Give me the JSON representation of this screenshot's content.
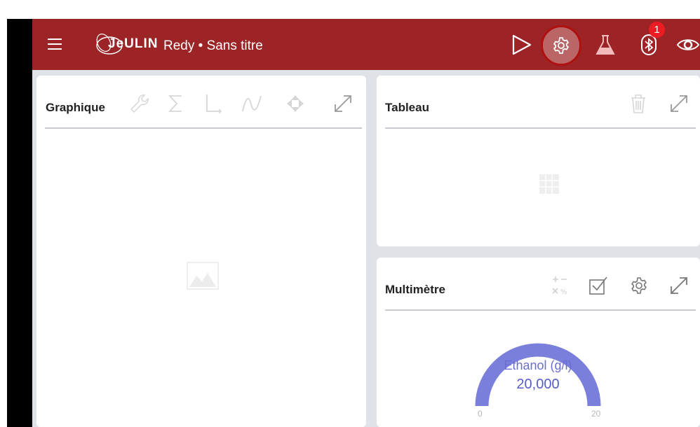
{
  "app": {
    "brand": "JeULIN",
    "title": "Redy • Sans titre",
    "bar_color": "#9c2426",
    "bluetooth_badge": "1"
  },
  "toolbar": {
    "icons": [
      "menu-icon",
      "play-icon",
      "settings-icon",
      "flask-icon",
      "bluetooth-icon",
      "eye-icon"
    ]
  },
  "graph_panel": {
    "title": "Graphique",
    "tools": [
      "wrench-icon",
      "sigma-icon",
      "axes-icon",
      "curve-icon",
      "move-icon",
      "expand-icon"
    ]
  },
  "table_panel": {
    "title": "Tableau",
    "tools": [
      "trash-icon",
      "expand-icon"
    ]
  },
  "multimeter_panel": {
    "title": "Multimètre",
    "tools": [
      "calculator-icon",
      "checkbox-icon",
      "gear-icon",
      "expand-icon"
    ],
    "gauge": {
      "label": "Ethanol (g/l)",
      "value": "20,000",
      "min": "0",
      "max": "20",
      "fraction": 1.0,
      "color": "#7b7fdc"
    }
  }
}
